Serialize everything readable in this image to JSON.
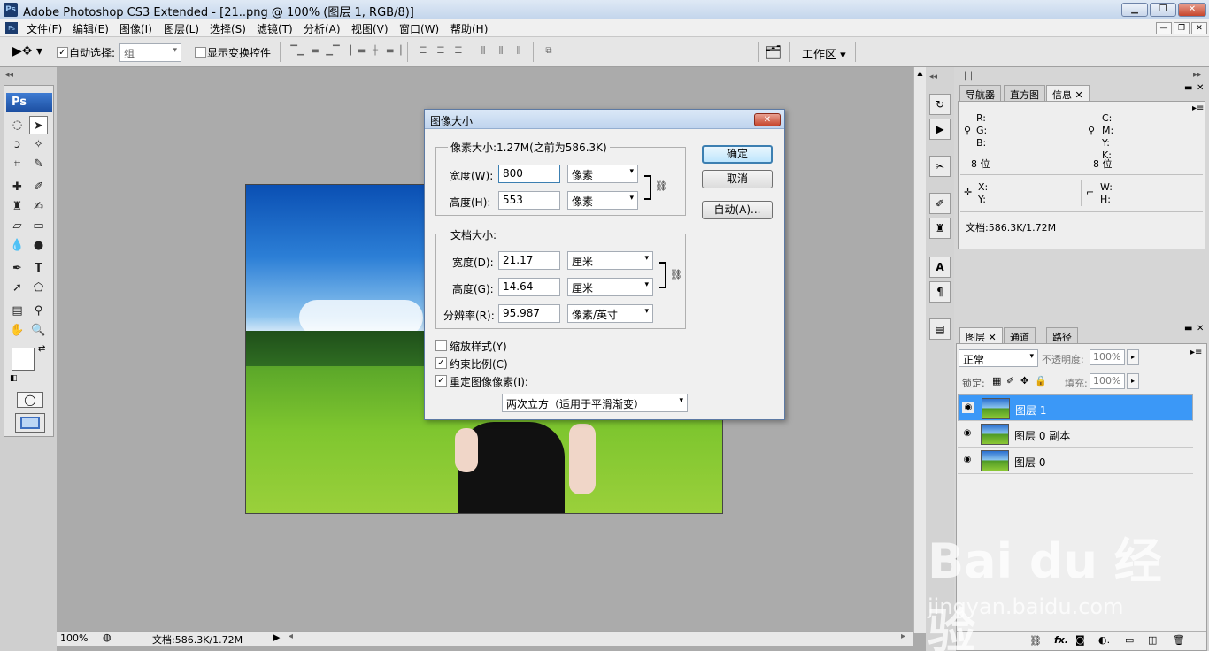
{
  "window": {
    "title": "Adobe Photoshop CS3 Extended - [21..png @ 100% (图层 1, RGB/8)]",
    "logo": "Ps"
  },
  "menu": [
    "文件(F)",
    "编辑(E)",
    "图像(I)",
    "图层(L)",
    "选择(S)",
    "滤镜(T)",
    "分析(A)",
    "视图(V)",
    "窗口(W)",
    "帮助(H)"
  ],
  "options": {
    "auto_select_label": "自动选择:",
    "auto_select_value": "组",
    "show_transform_label": "显示变换控件",
    "workspace_label": "工作区 ▾"
  },
  "toolbar": {
    "ps_label": "Ps"
  },
  "status": {
    "zoom": "100%",
    "doc": "文档:586.3K/1.72M"
  },
  "dialog": {
    "title": "图像大小",
    "pixel_group_title": "像素大小:1.27M(之前为586.3K)",
    "width_label": "宽度(W):",
    "width_value": "800",
    "width_unit": "像素",
    "height_label": "高度(H):",
    "height_value": "553",
    "height_unit": "像素",
    "doc_group_title": "文档大小:",
    "doc_width_label": "宽度(D):",
    "doc_width_value": "21.17",
    "doc_width_unit": "厘米",
    "doc_height_label": "高度(G):",
    "doc_height_value": "14.64",
    "doc_height_unit": "厘米",
    "resolution_label": "分辨率(R):",
    "resolution_value": "95.987",
    "resolution_unit": "像素/英寸",
    "scale_styles_label": "缩放样式(Y)",
    "scale_styles_checked": false,
    "constrain_label": "约束比例(C)",
    "constrain_checked": true,
    "resample_label": "重定图像像素(I):",
    "resample_checked": true,
    "resample_method": "两次立方（适用于平滑渐变）",
    "ok_label": "确定",
    "cancel_label": "取消",
    "auto_label": "自动(A)..."
  },
  "info_panel": {
    "tabs": [
      "导航器",
      "直方图",
      "信息"
    ],
    "rgb": [
      "R:",
      "G:",
      "B:"
    ],
    "cmyk": [
      "C:",
      "M:",
      "Y:",
      "K:"
    ],
    "bit_left": "8 位",
    "bit_right": "8 位",
    "xy": [
      "X:",
      "Y:"
    ],
    "wh": [
      "W:",
      "H:"
    ],
    "doc": "文档:586.3K/1.72M"
  },
  "layers_panel": {
    "tabs": [
      "图层",
      "通道",
      "路径"
    ],
    "blend_mode": "正常",
    "opacity_label": "不透明度:",
    "opacity_value": "100%",
    "lock_label": "锁定:",
    "fill_label": "填充:",
    "fill_value": "100%",
    "layers": [
      {
        "name": "图层 1"
      },
      {
        "name": "图层 0 副本"
      },
      {
        "name": "图层 0"
      }
    ]
  },
  "watermark": {
    "line1": "Bai du 经验",
    "line2": "jingyan.baidu.com"
  }
}
